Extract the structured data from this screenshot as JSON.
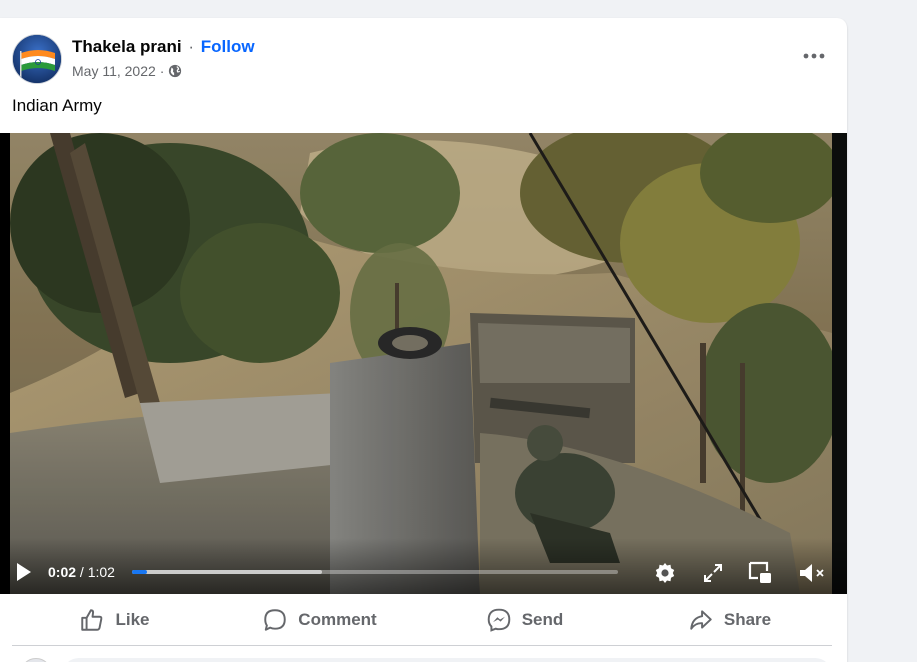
{
  "post": {
    "author": "Thakela prani",
    "separator": "·",
    "follow_label": "Follow",
    "date": "May 11, 2022",
    "date_separator": "·",
    "audience_icon": "globe-icon",
    "more_icon": "more-horizontal-icon",
    "text": "Indian Army"
  },
  "video": {
    "current_time": "0:02",
    "time_separator": "/",
    "duration": "1:02",
    "played_fraction": 0.03,
    "buffered_fraction": 0.39,
    "icons": [
      "play-icon",
      "settings-icon",
      "fullscreen-icon",
      "picture-in-picture-icon",
      "muted-volume-icon"
    ]
  },
  "actions": [
    {
      "label": "Like",
      "icon": "like-icon"
    },
    {
      "label": "Comment",
      "icon": "comment-icon"
    },
    {
      "label": "Send",
      "icon": "messenger-icon"
    },
    {
      "label": "Share",
      "icon": "share-icon"
    }
  ],
  "colors": {
    "accent": "#0866ff",
    "progress": "#1877f2",
    "secondary_text": "#65676b"
  }
}
